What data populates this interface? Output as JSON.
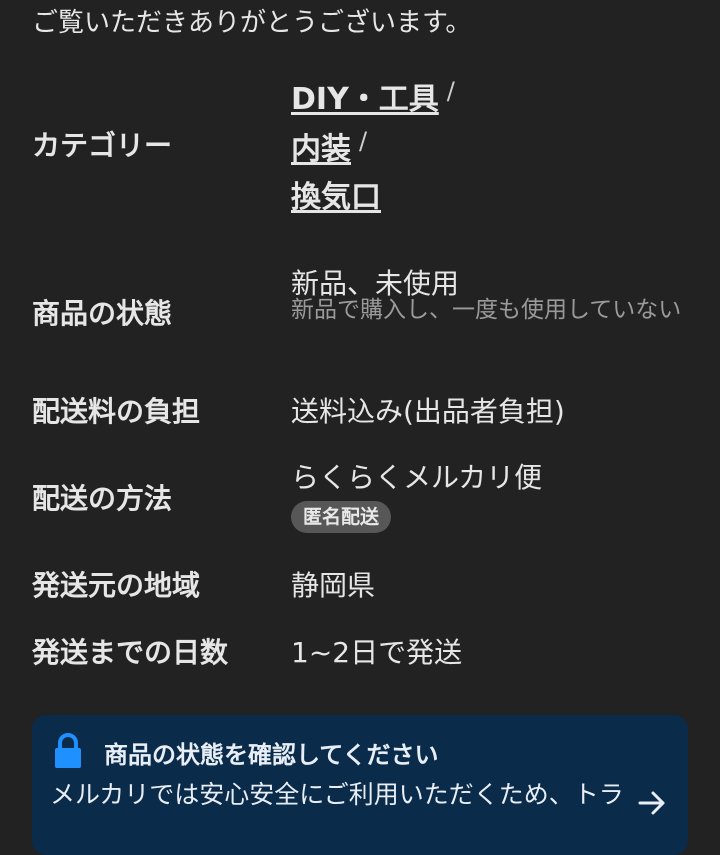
{
  "intro_text": "ご覧いただきありがとうございます。",
  "category": {
    "label": "カテゴリー",
    "path": [
      "DIY・工具",
      "内装",
      "換気口"
    ],
    "separator": "/"
  },
  "condition": {
    "label": "商品の状態",
    "value": "新品、未使用",
    "description": "新品で購入し、一度も使用していない"
  },
  "shipping_fee": {
    "label": "配送料の負担",
    "value": "送料込み(出品者負担)"
  },
  "shipping_method": {
    "label": "配送の方法",
    "value": "らくらくメルカリ便",
    "badge": "匿名配送"
  },
  "ship_from": {
    "label": "発送元の地域",
    "value": "静岡県"
  },
  "ship_days": {
    "label": "発送までの日数",
    "value": "1~2日で発送"
  },
  "notice": {
    "icon": "lock-icon",
    "title": "商品の状態を確認してください",
    "body": "メルカリでは安心安全にご利用いただくため、トラ",
    "accent_color": "#1e90ff",
    "background_color": "#0b2b4a"
  }
}
